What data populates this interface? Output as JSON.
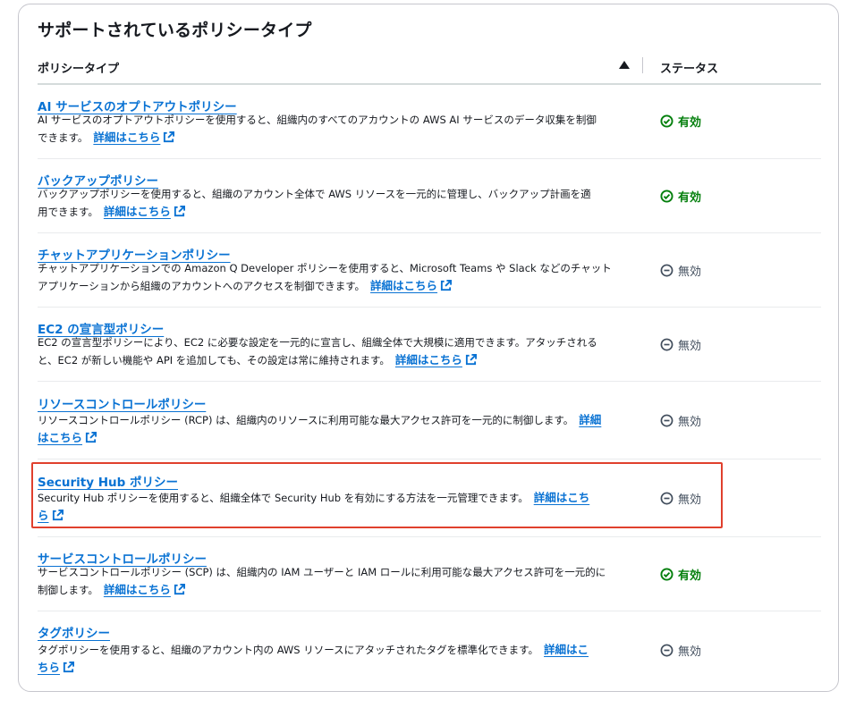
{
  "panel": {
    "title": "サポートされているポリシータイプ"
  },
  "table": {
    "col_type": "ポリシータイプ",
    "col_status": "ステータス",
    "more_label": "詳細はこちら",
    "rows": [
      {
        "name": "AI サービスのオプトアウトポリシー",
        "desc_line1": "AI サービスのオプトアウトポリシーを使用すると、組織内のすべてのアカウントの AWS AI サービスのデータ収集を制御",
        "desc_line2": "できます。",
        "more_line1": "",
        "more_line2": "詳細はこちら",
        "status": "有効",
        "status_icon": "check-circle-icon"
      },
      {
        "name": "バックアップポリシー",
        "desc_line1": "バックアップポリシーを使用すると、組織のアカウント全体で AWS リソースを一元的に管理し、バックアップ計画を適",
        "desc_line2": "用できます。",
        "more_line1": "",
        "more_line2": "詳細はこちら",
        "status": "有効",
        "status_icon": "check-circle-icon"
      },
      {
        "name": "チャットアプリケーションポリシー",
        "desc_line1": "チャットアプリケーションでの Amazon Q Developer ポリシーを使用すると、Microsoft Teams や Slack などのチャット",
        "desc_line2": "アプリケーションから組織のアカウントへのアクセスを制御できます。",
        "more_line1": "",
        "more_line2": "詳細はこちら",
        "status": "無効",
        "status_icon": "minus-circle-icon"
      },
      {
        "name": "EC2 の宣言型ポリシー",
        "desc_line1": "EC2 の宣言型ポリシーにより、EC2 に必要な設定を一元的に宣言し、組織全体で大規模に適用できます。アタッチされる",
        "desc_line2": "と、EC2 が新しい機能や API を追加しても、その設定は常に維持されます。",
        "more_line1": "",
        "more_line2": "詳細はこちら",
        "status": "無効",
        "status_icon": "minus-circle-icon"
      },
      {
        "name": "リソースコントロールポリシー",
        "desc_line1": "リソースコントロールポリシー (RCP) は、組織内のリソースに利用可能な最大アクセス許可を一元的に制御します。",
        "desc_line2": "",
        "more_line1": "詳細",
        "more_line2": "はこちら",
        "status": "無効",
        "status_icon": "minus-circle-icon"
      },
      {
        "name": "Security Hub ポリシー",
        "desc_line1": "Security Hub ポリシーを使用すると、組織全体で Security Hub を有効にする方法を一元管理できます。",
        "desc_line2": "",
        "more_line1": "詳細はこち",
        "more_line2": "ら",
        "status": "無効",
        "status_icon": "minus-circle-icon"
      },
      {
        "name": "サービスコントロールポリシー",
        "desc_line1": "サービスコントロールポリシー (SCP) は、組織内の IAM ユーザーと IAM ロールに利用可能な最大アクセス許可を一元的に",
        "desc_line2": "制御します。",
        "more_line1": "",
        "more_line2": "詳細はこちら",
        "status": "有効",
        "status_icon": "check-circle-icon"
      },
      {
        "name": "タグポリシー",
        "desc_line1": "タグポリシーを使用すると、組織のアカウント内の AWS リソースにアタッチされたタグを標準化できます。",
        "desc_line2": "",
        "more_line1": "詳細はこ",
        "more_line2": "ちら",
        "status": "無効",
        "status_icon": "minus-circle-icon"
      }
    ]
  },
  "colors": {
    "link": "#0972d3",
    "enabled": "#037f0c",
    "disabled": "#414d5c",
    "highlight": "#e0402d"
  },
  "highlighted_row": "Security Hub ポリシー"
}
